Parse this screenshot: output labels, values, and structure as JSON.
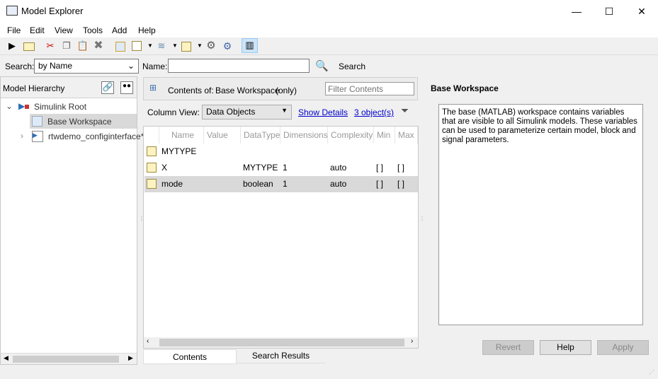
{
  "window": {
    "title": "Model Explorer",
    "minimize": "—",
    "maximize": "☐",
    "close": "✕"
  },
  "menu": [
    "File",
    "Edit",
    "View",
    "Tools",
    "Add",
    "Help"
  ],
  "toolbar": {
    "icons": [
      "new-model-icon",
      "open-icon",
      "cut-icon",
      "copy-icon",
      "paste-icon",
      "delete-icon",
      "matlab-variable-icon",
      "simulink-parameter-icon",
      "simulink-signal-icon",
      "bus-icon",
      "configuration-icon",
      "model-settings-icon",
      "dialog-view-icon"
    ]
  },
  "search": {
    "label": "Search:",
    "mode": "by Name",
    "name_label": "Name:",
    "name_value": "",
    "button": "Search"
  },
  "hierarchy": {
    "title": "Model Hierarchy",
    "items": [
      {
        "label": "Simulink Root",
        "expanded": true
      },
      {
        "label": "Base Workspace",
        "selected": true
      },
      {
        "label": "rtwdemo_configinterface*",
        "expanded": false
      }
    ]
  },
  "contents": {
    "prefix": "Contents of:",
    "scope": "Base Workspace",
    "suffix": "(only)",
    "filter_placeholder": "Filter Contents",
    "column_view_label": "Column View:",
    "column_view": "Data Objects",
    "show_details": "Show Details",
    "count": "3 object(s)",
    "columns": [
      "Name",
      "Value",
      "DataType",
      "Dimensions",
      "Complexity",
      "Min",
      "Max"
    ],
    "rows": [
      {
        "name": "MYTYPE",
        "value": "",
        "datatype": "",
        "dimensions": "",
        "complexity": "",
        "min": "",
        "max": ""
      },
      {
        "name": "X",
        "value": "",
        "datatype": "MYTYPE",
        "dimensions": "1",
        "complexity": "auto",
        "min": "[ ]",
        "max": "[ ]"
      },
      {
        "name": "mode",
        "value": "",
        "datatype": "boolean",
        "dimensions": "1",
        "complexity": "auto",
        "min": "[ ]",
        "max": "[ ]",
        "selected": true
      }
    ],
    "tabs": [
      "Contents",
      "Search Results"
    ]
  },
  "details": {
    "title": "Base Workspace",
    "description": "The base (MATLAB) workspace contains variables that are visible to all Simulink models. These variables can be used to parameterize certain model, block and signal parameters.",
    "revert": "Revert",
    "help": "Help",
    "apply": "Apply"
  }
}
